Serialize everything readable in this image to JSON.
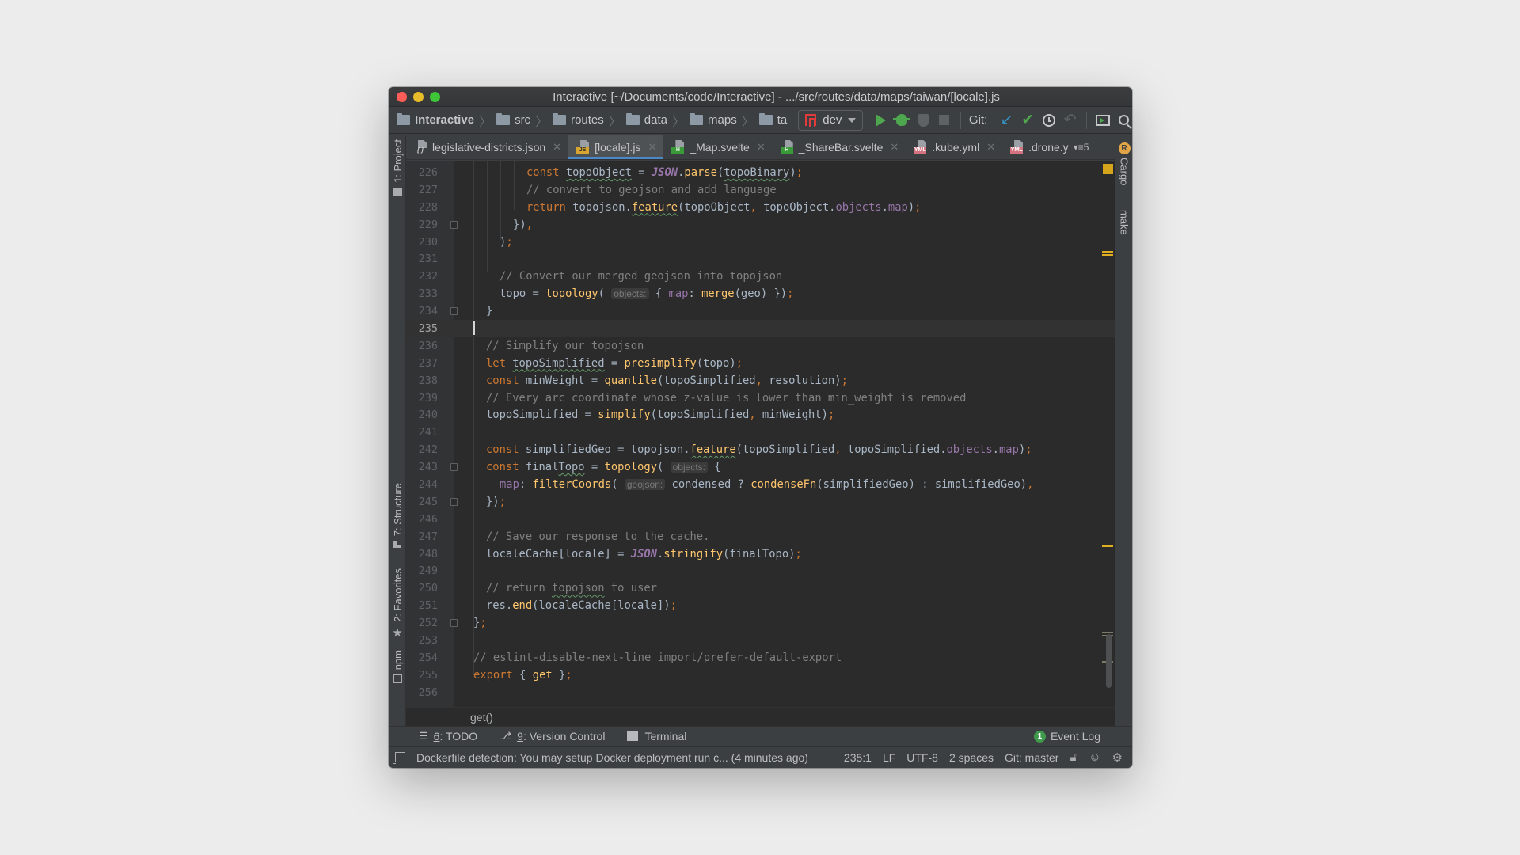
{
  "window": {
    "title": "Interactive [~/Documents/code/Interactive] - .../src/routes/data/maps/taiwan/[locale].js"
  },
  "toolbar": {
    "breadcrumbs": [
      "Interactive",
      "src",
      "routes",
      "data",
      "maps",
      "ta"
    ],
    "run_config": "dev",
    "git_label": "Git:",
    "icons": [
      "run-icon",
      "debug-icon",
      "coverage-icon",
      "stop-icon",
      "git-update-icon",
      "git-commit-icon",
      "git-history-icon",
      "git-rollback-icon",
      "terminal-window-icon",
      "search-icon"
    ]
  },
  "tabs": [
    {
      "label": "legislative-districts.json",
      "icon": "json",
      "active": false
    },
    {
      "label": "[locale].js",
      "icon": "js",
      "active": true
    },
    {
      "label": "_Map.svelte",
      "icon": "svelte",
      "active": false
    },
    {
      "label": "_ShareBar.svelte",
      "icon": "svelte",
      "active": false
    },
    {
      "label": ".kube.yml",
      "icon": "yml",
      "active": false
    },
    {
      "label": ".drone.y",
      "icon": "yml",
      "active": false
    }
  ],
  "tabs_overflow_count": "5",
  "left_stripe": {
    "project": "1: Project",
    "structure": "7: Structure",
    "favorites": "2: Favorites",
    "npm": "npm"
  },
  "right_stripe": {
    "cargo": "Cargo",
    "make": "make"
  },
  "editor": {
    "current_line": 235,
    "lines": [
      {
        "n": "226"
      },
      {
        "n": "227"
      },
      {
        "n": "228"
      },
      {
        "n": "229"
      },
      {
        "n": "230"
      },
      {
        "n": "231"
      },
      {
        "n": "232"
      },
      {
        "n": "233"
      },
      {
        "n": "234"
      },
      {
        "n": "235"
      },
      {
        "n": "236"
      },
      {
        "n": "237"
      },
      {
        "n": "238"
      },
      {
        "n": "239"
      },
      {
        "n": "240"
      },
      {
        "n": "241"
      },
      {
        "n": "242"
      },
      {
        "n": "243"
      },
      {
        "n": "244"
      },
      {
        "n": "245"
      },
      {
        "n": "246"
      },
      {
        "n": "247"
      },
      {
        "n": "248"
      },
      {
        "n": "249"
      },
      {
        "n": "250"
      },
      {
        "n": "251"
      },
      {
        "n": "252"
      },
      {
        "n": "253"
      },
      {
        "n": "254"
      },
      {
        "n": "255"
      },
      {
        "n": "256"
      }
    ],
    "code": {
      "l226": [
        "const",
        " ",
        "topoObject",
        " = ",
        "JSON",
        ".",
        "parse",
        "(",
        "topoBinary",
        ")",
        ";"
      ],
      "l227": "// convert to geojson and add language",
      "l228": [
        "return",
        " topojson.",
        "feature",
        "(topoObject",
        ",",
        " topoObject.",
        "objects",
        ".",
        "map",
        ")",
        ";"
      ],
      "l229": [
        "}",
        ")",
        ","
      ],
      "l230": [
        ")",
        ";"
      ],
      "l232": "// Convert our merged geojson into topojson",
      "l233": [
        "topo = ",
        "topology",
        "(",
        "objects:",
        " { ",
        "map",
        ": ",
        "merge",
        "(geo) })",
        ";"
      ],
      "l234": "}",
      "l236": "// Simplify our topojson",
      "l237": [
        "let",
        " ",
        "topoSimplified",
        " = ",
        "presimplify",
        "(topo)",
        ";"
      ],
      "l238": [
        "const",
        " minWeight = ",
        "quantile",
        "(topoSimplified",
        ",",
        " resolution)",
        ";"
      ],
      "l239": "// Every arc coordinate whose z-value is lower than min_weight is removed",
      "l240": [
        "topoSimplified = ",
        "simplify",
        "(topoSimplified",
        ",",
        " minWeight)",
        ";"
      ],
      "l242": [
        "const",
        " simplifiedGeo = topojson.",
        "feature",
        "(topoSimplified",
        ",",
        " topoSimplified.",
        "objects",
        ".",
        "map",
        ")",
        ";"
      ],
      "l243": [
        "const",
        " final",
        "Topo",
        " = ",
        "topology",
        "(",
        "objects:",
        " {"
      ],
      "l244": [
        "map",
        ": ",
        "filterCoords",
        "(",
        "geojson:",
        " condensed ? ",
        "condenseFn",
        "(simplifiedGeo) : simplifiedGeo)",
        ","
      ],
      "l245": [
        "})",
        ";"
      ],
      "l247": "// Save our response to the cache.",
      "l248": [
        "localeCache[locale] = ",
        "JSON",
        ".",
        "stringify",
        "(finalTopo)",
        ";"
      ],
      "l250": [
        "// return ",
        "topojson",
        " to user"
      ],
      "l251": [
        "res.",
        "end",
        "(localeCache[locale])",
        ";"
      ],
      "l252": [
        "}",
        ";"
      ],
      "l254": "// eslint-disable-next-line import/prefer-default-export",
      "l255": [
        "export",
        " { ",
        "get",
        " }",
        ";"
      ]
    }
  },
  "breadcrumb_footer": "get()",
  "tool_windows": {
    "todo": {
      "num": "6",
      "label": ": TODO"
    },
    "vcs": {
      "num": "9",
      "label": ": Version Control"
    },
    "terminal": "Terminal",
    "event_log": "Event Log",
    "event_count": "1"
  },
  "status_bar": {
    "message": "Dockerfile detection: You may setup Docker deployment run c... (4 minutes ago)",
    "position": "235:1",
    "line_sep": "LF",
    "encoding": "UTF-8",
    "indent": "2 spaces",
    "git_branch": "Git: master"
  },
  "colors": {
    "accent": "#4a88c7",
    "keyword": "#cc7832",
    "function": "#ffc66d",
    "comment": "#808080",
    "property": "#9876aa",
    "text": "#a9b7c6",
    "editor_bg": "#2b2b2b"
  }
}
